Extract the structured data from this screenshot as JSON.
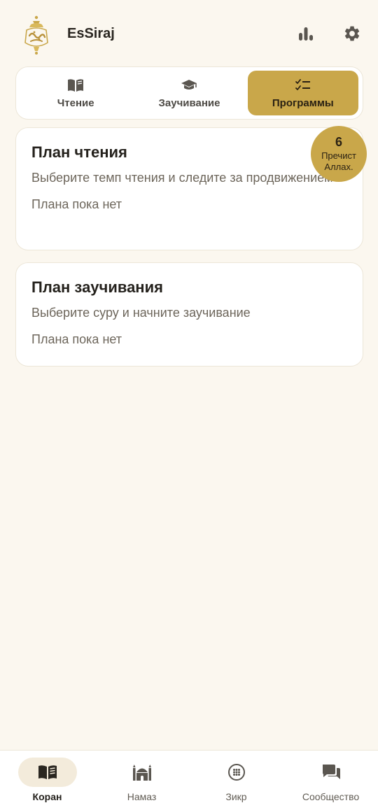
{
  "header": {
    "app_title": "EsSiraj",
    "icons": {
      "logo": "essiraj-lantern-logo",
      "stats": "bar-chart-icon",
      "settings": "gear-icon"
    }
  },
  "tabs": [
    {
      "label": "Чтение",
      "icon": "open-book-icon",
      "active": false
    },
    {
      "label": "Заучивание",
      "icon": "graduation-cap-icon",
      "active": false
    },
    {
      "label": "Программы",
      "icon": "checklist-icon",
      "active": true
    }
  ],
  "reading_plan": {
    "title": "План чтения",
    "description": "Выберите темп чтения и следите за продвижением",
    "empty": "Плана пока нет"
  },
  "badge": {
    "count": "6",
    "line1": "Пречист",
    "line2": "Аллах."
  },
  "memorization_plan": {
    "title": "План заучивания",
    "description": "Выберите суру и начните заучивание",
    "empty": "Плана пока нет"
  },
  "bottom_nav": [
    {
      "label": "Коран",
      "icon": "quran-book-icon",
      "active": true
    },
    {
      "label": "Намаз",
      "icon": "mosque-icon",
      "active": false
    },
    {
      "label": "Зикр",
      "icon": "tasbih-icon",
      "active": false
    },
    {
      "label": "Сообщество",
      "icon": "chat-bubbles-icon",
      "active": false
    }
  ],
  "colors": {
    "accent": "#c9a74a",
    "background": "#fbf7ef",
    "card": "#ffffff",
    "text": "#2a2620",
    "muted": "#6d665b"
  }
}
